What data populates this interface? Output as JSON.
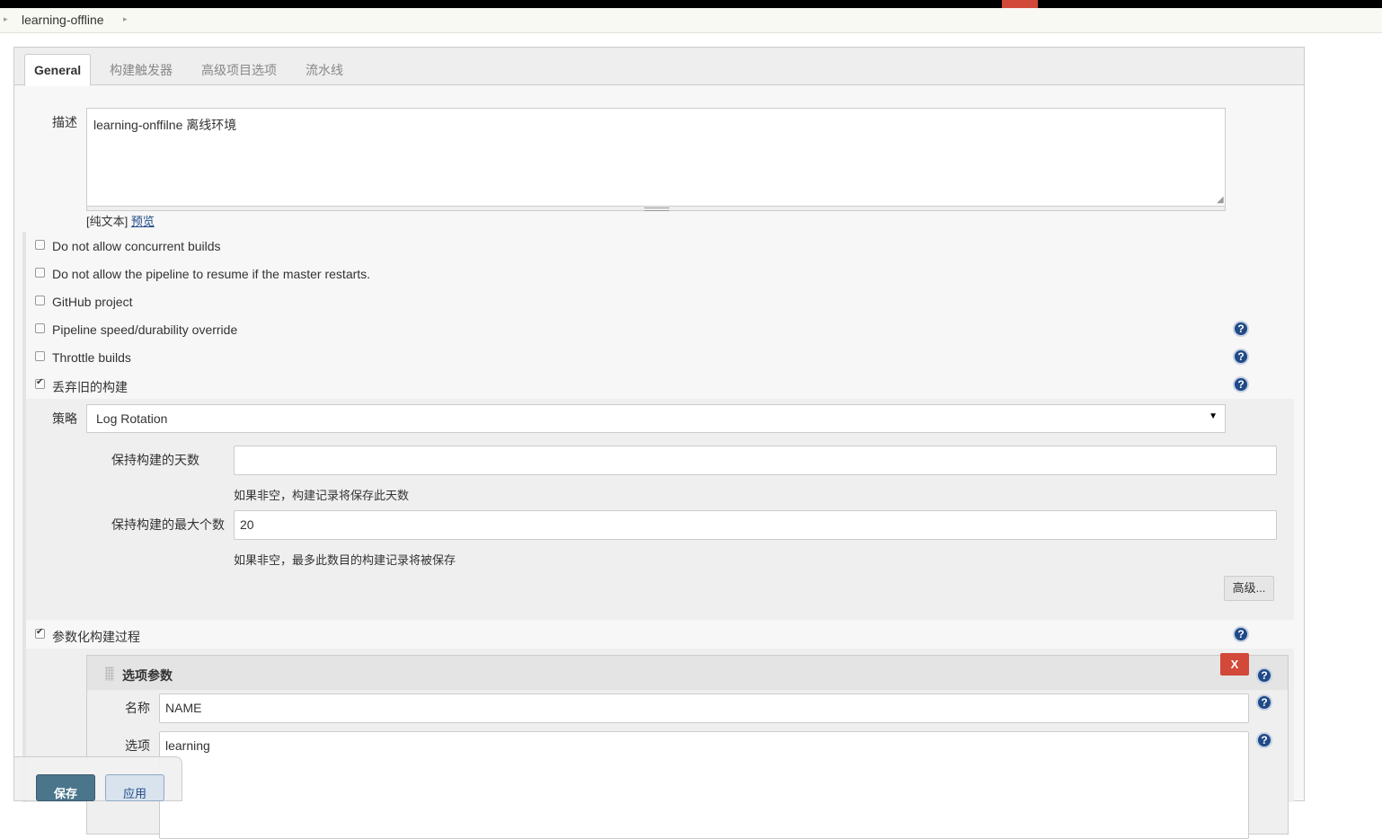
{
  "breadcrumb": {
    "item": "learning-offline"
  },
  "tabs": [
    "General",
    "构建触发器",
    "高级项目选项",
    "流水线"
  ],
  "description": {
    "label": "描述",
    "value": "learning-onffilne 离线环境",
    "raw_text": "[纯文本]",
    "preview": "预览"
  },
  "options": [
    {
      "label": "Do not allow concurrent builds",
      "checked": false
    },
    {
      "label": "Do not allow the pipeline to resume if the master restarts.",
      "checked": false
    },
    {
      "label": "GitHub project",
      "checked": false
    },
    {
      "label": "Pipeline speed/durability override",
      "checked": false
    },
    {
      "label": "Throttle builds",
      "checked": false
    },
    {
      "label": "丢弃旧的构建",
      "checked": true
    }
  ],
  "discard": {
    "strategy_label": "策略",
    "strategy_value": "Log Rotation",
    "days_label": "保持构建的天数",
    "days_value": "",
    "days_hint": "如果非空，构建记录将保存此天数",
    "max_label": "保持构建的最大个数",
    "max_value": "20",
    "max_hint": "如果非空，最多此数目的构建记录将被保存",
    "advanced_button": "高级..."
  },
  "parameterized": {
    "label": "参数化构建过程",
    "checked": true
  },
  "choice_param": {
    "title": "选项参数",
    "delete": "X",
    "name_label": "名称",
    "name_value": "NAME",
    "choices_label": "选项",
    "choices_value": "learning"
  },
  "footer": {
    "save": "保存",
    "apply": "应用"
  },
  "icons": {
    "help": "?",
    "caret": "▼",
    "breadcrumb_arrow": "▸"
  },
  "colors": {
    "accent_red": "#d24939",
    "help_blue": "#204a87",
    "save_blue": "#4b758b"
  }
}
